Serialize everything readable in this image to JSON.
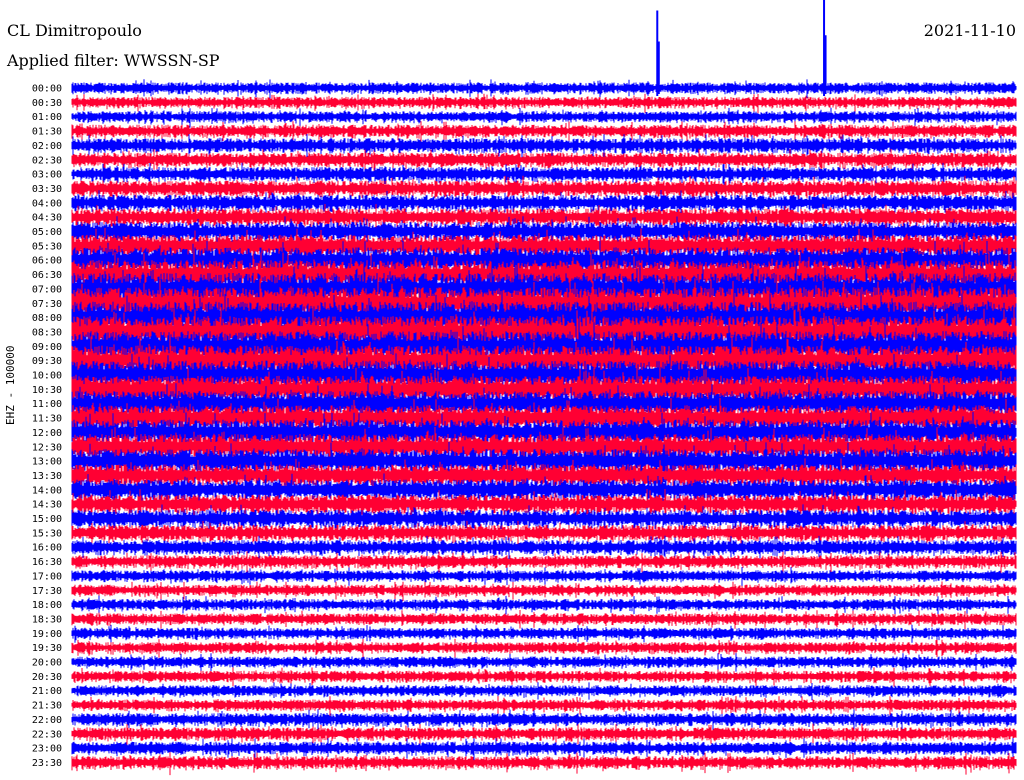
{
  "header": {
    "station": "CL Dimitropoulo",
    "filter": "Applied filter: WWSSN-SP",
    "date": "2021-11-10"
  },
  "chart_data": {
    "type": "line",
    "title": "CL Dimitropoulo",
    "subtitle": "Applied filter: WWSSN-SP",
    "date": "2021-11-10",
    "ylabel": "EHZ - 100000",
    "xlabel": "",
    "grid": false,
    "legend": "none",
    "row_labels": [
      "00:00",
      "00:30",
      "01:00",
      "01:30",
      "02:00",
      "02:30",
      "03:00",
      "03:30",
      "04:00",
      "04:30",
      "05:00",
      "05:30",
      "06:00",
      "06:30",
      "07:00",
      "07:30",
      "08:00",
      "08:30",
      "09:00",
      "09:30",
      "10:00",
      "10:30",
      "11:00",
      "11:30",
      "12:00",
      "12:30",
      "13:00",
      "13:30",
      "14:00",
      "14:30",
      "15:00",
      "15:30",
      "16:00",
      "16:30",
      "17:00",
      "17:30",
      "18:00",
      "18:30",
      "19:00",
      "19:30",
      "20:00",
      "20:30",
      "21:00",
      "21:30",
      "22:00",
      "22:30",
      "23:00",
      "23:30"
    ],
    "row_amplitude": [
      0.35,
      0.35,
      0.35,
      0.4,
      0.45,
      0.45,
      0.45,
      0.5,
      0.5,
      0.55,
      0.6,
      0.7,
      0.8,
      0.9,
      1.0,
      1.0,
      1.0,
      1.0,
      0.95,
      0.95,
      0.9,
      0.85,
      0.8,
      0.8,
      0.8,
      0.8,
      0.75,
      0.7,
      0.65,
      0.6,
      0.55,
      0.5,
      0.45,
      0.4,
      0.35,
      0.35,
      0.35,
      0.35,
      0.35,
      0.35,
      0.35,
      0.35,
      0.35,
      0.35,
      0.4,
      0.4,
      0.4,
      0.4
    ],
    "colors": {
      "trace_a": "#0000ff",
      "trace_b": "#ff0033"
    },
    "events": [
      {
        "row": 0,
        "minute": 18.6,
        "strength": 2.2,
        "label": ""
      },
      {
        "row": 0,
        "minute": 23.9,
        "strength": 6.0,
        "label": ""
      }
    ]
  }
}
